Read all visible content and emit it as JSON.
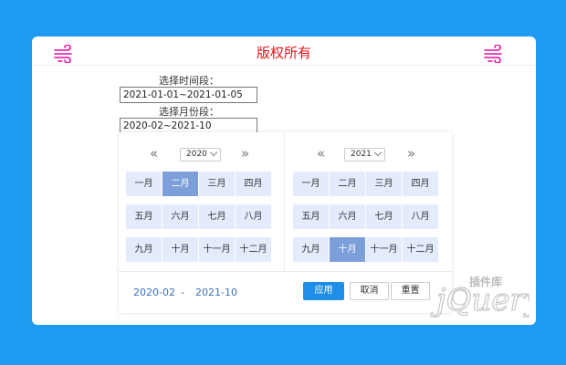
{
  "header": {
    "title": "版权所有",
    "left_icon": "wind-icon",
    "right_icon": "wind-icon"
  },
  "form": {
    "time_label": "选择时间段：",
    "time_value": "2021-01-01~2021-01-05",
    "month_label": "选择月份段：",
    "month_value": "2020-02~2021-10"
  },
  "picker": {
    "left": {
      "prev": "«",
      "next": "»",
      "year": "2020",
      "months": [
        "一月",
        "二月",
        "三月",
        "四月",
        "五月",
        "六月",
        "七月",
        "八月",
        "九月",
        "十月",
        "十一月",
        "十二月"
      ],
      "selected_index": 1
    },
    "right": {
      "prev": "«",
      "next": "»",
      "year": "2021",
      "months": [
        "一月",
        "二月",
        "三月",
        "四月",
        "五月",
        "六月",
        "七月",
        "八月",
        "九月",
        "十月",
        "十一月",
        "十二月"
      ],
      "selected_index": 9
    },
    "footer": {
      "start": "2020-02",
      "separator": "-",
      "end": "2021-10",
      "apply": "应用",
      "cancel": "取消",
      "reset": "重置"
    }
  },
  "watermark": {
    "text": "插件库",
    "logo": "jQuery"
  },
  "colors": {
    "background": "#1e9bf0",
    "title": "#e8141b",
    "icon": "#e60aa4",
    "month_bg": "#e3ebfc",
    "month_selected": "#7c9fd9",
    "apply": "#1e8ee8"
  }
}
